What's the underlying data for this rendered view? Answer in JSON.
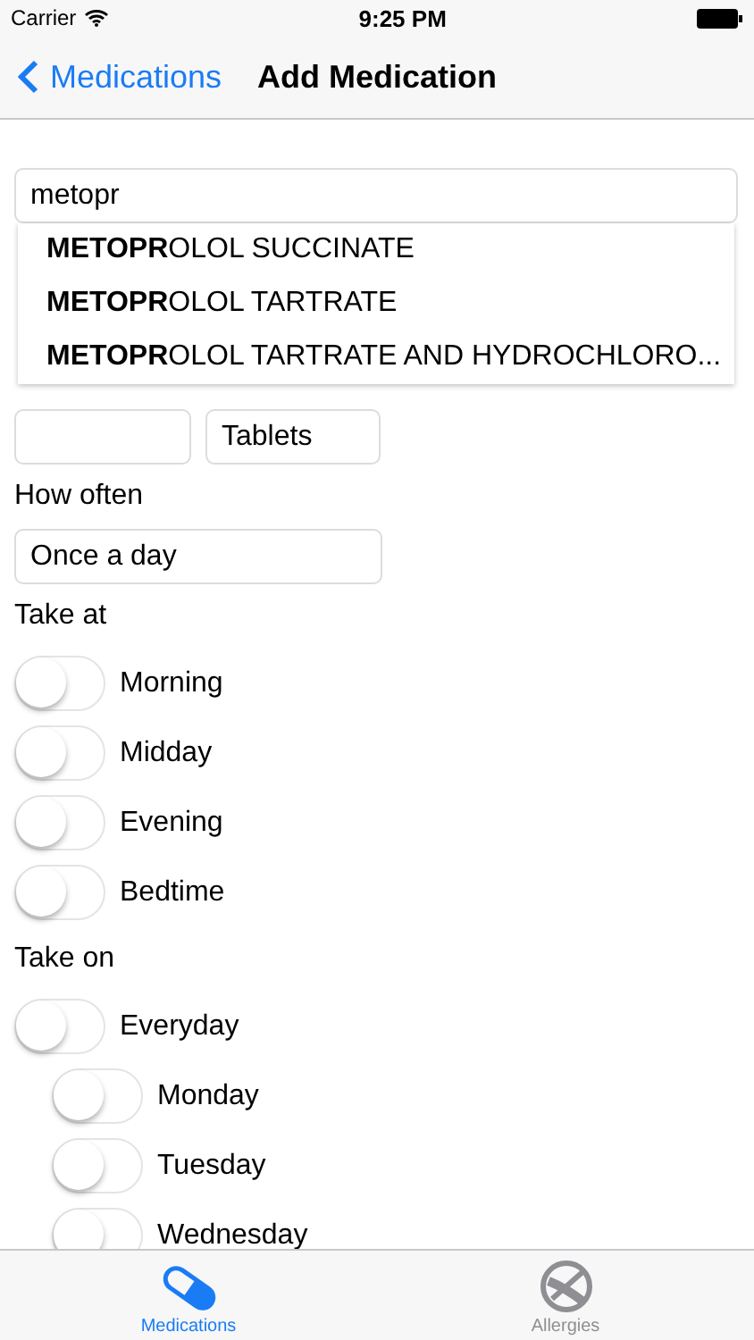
{
  "status_bar": {
    "carrier": "Carrier",
    "time": "9:25 PM"
  },
  "nav": {
    "back": "Medications",
    "title": "Add Medication"
  },
  "search": {
    "value": "metopr",
    "suggestions": [
      "**METOPR**OLOL SUCCINATE",
      "**METOPR**OLOL TARTRATE",
      "**METOPR**OLOL TARTRATE AND HYDROCHLORO..."
    ]
  },
  "dose": {
    "unit": "Tablets"
  },
  "how_often": {
    "label": "How often",
    "value": "Once a day"
  },
  "take_at": {
    "label": "Take at",
    "toggles": [
      {
        "label": "Morning",
        "on": false
      },
      {
        "label": "Midday",
        "on": false
      },
      {
        "label": "Evening",
        "on": false
      },
      {
        "label": "Bedtime",
        "on": false
      }
    ]
  },
  "take_on": {
    "label": "Take on",
    "toggles": [
      {
        "label": "Everyday",
        "on": false,
        "children": [
          {
            "label": "Monday",
            "on": false
          },
          {
            "label": "Tuesday",
            "on": false
          },
          {
            "label": "Wednesday",
            "on": false
          }
        ]
      }
    ]
  },
  "tabs": [
    {
      "label": "Medications",
      "kind": "pill",
      "selected": true
    },
    {
      "label": "Allergies",
      "kind": "ban",
      "selected": false
    }
  ]
}
